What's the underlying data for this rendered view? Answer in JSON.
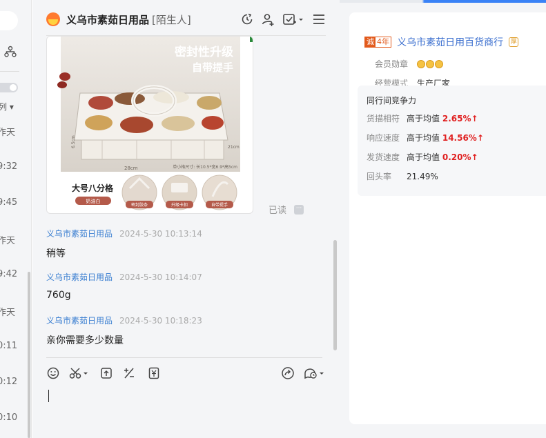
{
  "conversation_list": {
    "sort_label": "列 ▾",
    "times": [
      "作天",
      "9:32",
      "9:45",
      "作天",
      "9:42",
      "作天",
      "0:11",
      "0:12",
      "0:10"
    ]
  },
  "chat": {
    "title": "义乌市素茹日用品",
    "tag": "[陌生人]",
    "product_image": {
      "headline_1": "密封性升级",
      "headline_2": "自带提手",
      "dim_width": "28cm",
      "dim_depth": "6.5cm",
      "dim_side": "21cm",
      "note": "单小格尺寸: 长10.5*宽6.9*高5cm",
      "caption_title": "大号八分格",
      "caption_color": "奶油白",
      "features": [
        "密封胶条",
        "升级卡扣",
        "自带提手"
      ]
    },
    "read_status": "已读",
    "messages": [
      {
        "sender": "义乌市素茹日用品",
        "time": "2024-5-30 10:13:14",
        "text": "稍等"
      },
      {
        "sender": "义乌市素茹日用品",
        "time": "2024-5-30 10:14:07",
        "text": "760g"
      },
      {
        "sender": "义乌市素茹日用品",
        "time": "2024-5-30 10:18:23",
        "text": "亲你需要多少数量"
      }
    ]
  },
  "shop_panel": {
    "years_badge_prefix": "诚",
    "years_badge": "4年",
    "shop_name": "义乌市素茹日用百货商行",
    "member_medal_label": "会员勋章",
    "medal_count": 3,
    "business_mode_label": "经营模式",
    "business_mode": "生产厂家",
    "peer_title": "同行间竞争力",
    "metrics": [
      {
        "label": "货描相符",
        "prefix": "高于均值",
        "value": "2.65%",
        "arrow": "↑"
      },
      {
        "label": "响应速度",
        "prefix": "高于均值",
        "value": "14.56%",
        "arrow": "↑"
      },
      {
        "label": "发货速度",
        "prefix": "高于均值",
        "value": "0.20%",
        "arrow": "↑"
      }
    ],
    "repeat_rate_label": "回头率",
    "repeat_rate": "21.49%"
  },
  "colors": {
    "accent_blue": "#3b7fd1",
    "metric_red": "#e02020",
    "badge_orange": "#e25a1c"
  }
}
